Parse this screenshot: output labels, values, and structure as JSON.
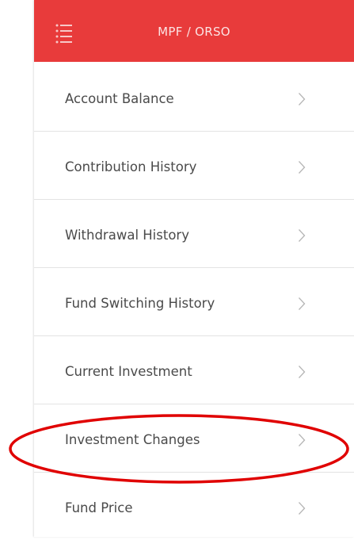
{
  "header": {
    "title": "MPF / ORSO",
    "menu_icon": "hamburger-list-icon",
    "background_color": "#e83b3b"
  },
  "menu": {
    "items": [
      {
        "label": "Account Balance",
        "icon": "chevron-right-icon"
      },
      {
        "label": "Contribution History",
        "icon": "chevron-right-icon"
      },
      {
        "label": "Withdrawal History",
        "icon": "chevron-right-icon"
      },
      {
        "label": "Fund Switching History",
        "icon": "chevron-right-icon"
      },
      {
        "label": "Current Investment",
        "icon": "chevron-right-icon"
      },
      {
        "label": "Investment Changes",
        "icon": "chevron-right-icon"
      },
      {
        "label": "Fund Price",
        "icon": "chevron-right-icon"
      }
    ]
  },
  "annotation": {
    "shape": "ellipse",
    "color": "#e00000",
    "highlights": "Investment Changes"
  }
}
